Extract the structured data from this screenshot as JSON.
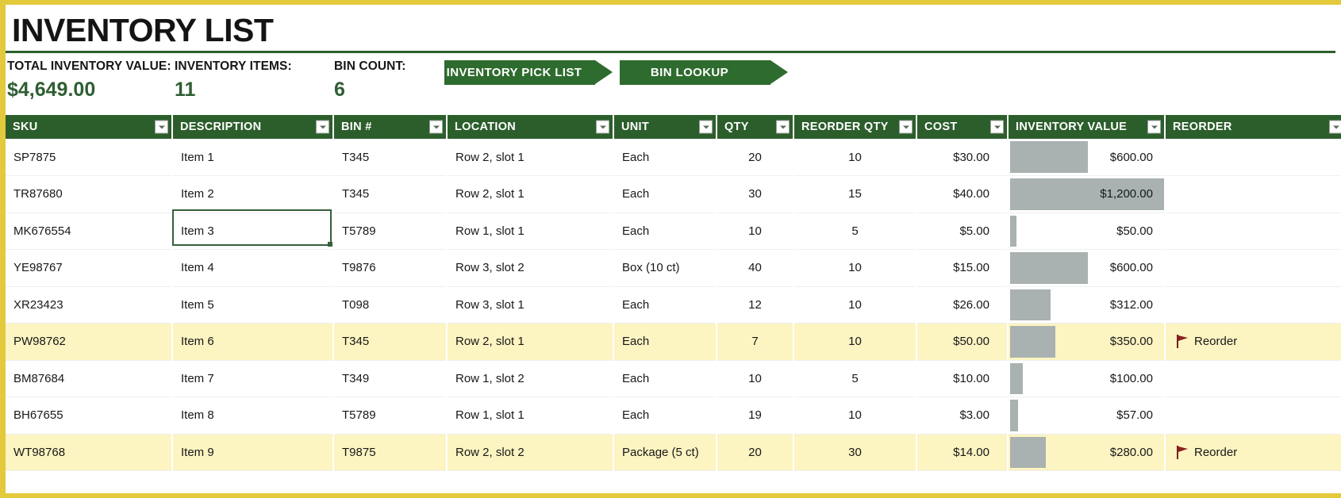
{
  "page_title": "INVENTORY LIST",
  "theme": {
    "header_green": "#2C5E2C",
    "accent_yellow": "#E3C93C",
    "highlight_row": "#FCF4C1",
    "data_bar_gray": "#A9B1B1",
    "value_green": "#2F5E33",
    "flag_red": "#8B2020"
  },
  "summary": {
    "total_label": "TOTAL INVENTORY VALUE:",
    "total_value": "$4,649.00",
    "items_label": "INVENTORY ITEMS:",
    "items_value": "11",
    "bins_label": "BIN COUNT:",
    "bins_value": "6"
  },
  "banners": {
    "pick_list": "INVENTORY PICK LIST",
    "bin_lookup": "BIN LOOKUP"
  },
  "table": {
    "columns": [
      {
        "label": "SKU",
        "filter": true
      },
      {
        "label": "DESCRIPTION",
        "filter": true
      },
      {
        "label": "BIN #",
        "filter": true
      },
      {
        "label": "LOCATION",
        "filter": true
      },
      {
        "label": "UNIT",
        "filter": true
      },
      {
        "label": "QTY",
        "filter": true
      },
      {
        "label": "REORDER QTY",
        "filter": true
      },
      {
        "label": "COST",
        "filter": true
      },
      {
        "label": "INVENTORY VALUE",
        "filter": true
      },
      {
        "label": "REORDER",
        "filter": true
      }
    ],
    "rows": [
      {
        "sku": "SP7875",
        "description": "Item 1",
        "bin": "T345",
        "location": "Row 2, slot 1",
        "unit": "Each",
        "qty": "20",
        "reorder_qty": "10",
        "cost": "$30.00",
        "inventory_value": "$600.00",
        "bar_pct": 50,
        "reorder": "",
        "highlight": false
      },
      {
        "sku": "TR87680",
        "description": "Item 2",
        "bin": "T345",
        "location": "Row 2, slot 1",
        "unit": "Each",
        "qty": "30",
        "reorder_qty": "15",
        "cost": "$40.00",
        "inventory_value": "$1,200.00",
        "bar_pct": 100,
        "reorder": "",
        "highlight": false
      },
      {
        "sku": "MK676554",
        "description": "Item 3",
        "bin": "T5789",
        "location": "Row 1, slot 1",
        "unit": "Each",
        "qty": "10",
        "reorder_qty": "5",
        "cost": "$5.00",
        "inventory_value": "$50.00",
        "bar_pct": 4,
        "reorder": "",
        "highlight": false
      },
      {
        "sku": "YE98767",
        "description": "Item 4",
        "bin": "T9876",
        "location": "Row 3, slot 2",
        "unit": "Box (10 ct)",
        "qty": "40",
        "reorder_qty": "10",
        "cost": "$15.00",
        "inventory_value": "$600.00",
        "bar_pct": 50,
        "reorder": "",
        "highlight": false
      },
      {
        "sku": "XR23423",
        "description": "Item 5",
        "bin": "T098",
        "location": "Row 3, slot 1",
        "unit": "Each",
        "qty": "12",
        "reorder_qty": "10",
        "cost": "$26.00",
        "inventory_value": "$312.00",
        "bar_pct": 26,
        "reorder": "",
        "highlight": false
      },
      {
        "sku": "PW98762",
        "description": "Item 6",
        "bin": "T345",
        "location": "Row 2, slot 1",
        "unit": "Each",
        "qty": "7",
        "reorder_qty": "10",
        "cost": "$50.00",
        "inventory_value": "$350.00",
        "bar_pct": 29,
        "reorder": "Reorder",
        "highlight": true
      },
      {
        "sku": "BM87684",
        "description": "Item 7",
        "bin": "T349",
        "location": "Row 1, slot 2",
        "unit": "Each",
        "qty": "10",
        "reorder_qty": "5",
        "cost": "$10.00",
        "inventory_value": "$100.00",
        "bar_pct": 8,
        "reorder": "",
        "highlight": false
      },
      {
        "sku": "BH67655",
        "description": "Item 8",
        "bin": "T5789",
        "location": "Row 1, slot 1",
        "unit": "Each",
        "qty": "19",
        "reorder_qty": "10",
        "cost": "$3.00",
        "inventory_value": "$57.00",
        "bar_pct": 5,
        "reorder": "",
        "highlight": false
      },
      {
        "sku": "WT98768",
        "description": "Item 9",
        "bin": "T9875",
        "location": "Row 2, slot 2",
        "unit": "Package (5 ct)",
        "qty": "20",
        "reorder_qty": "30",
        "cost": "$14.00",
        "inventory_value": "$280.00",
        "bar_pct": 23,
        "reorder": "Reorder",
        "highlight": true
      }
    ]
  },
  "selection": {
    "cell_value": "Item 3",
    "column": "DESCRIPTION"
  }
}
